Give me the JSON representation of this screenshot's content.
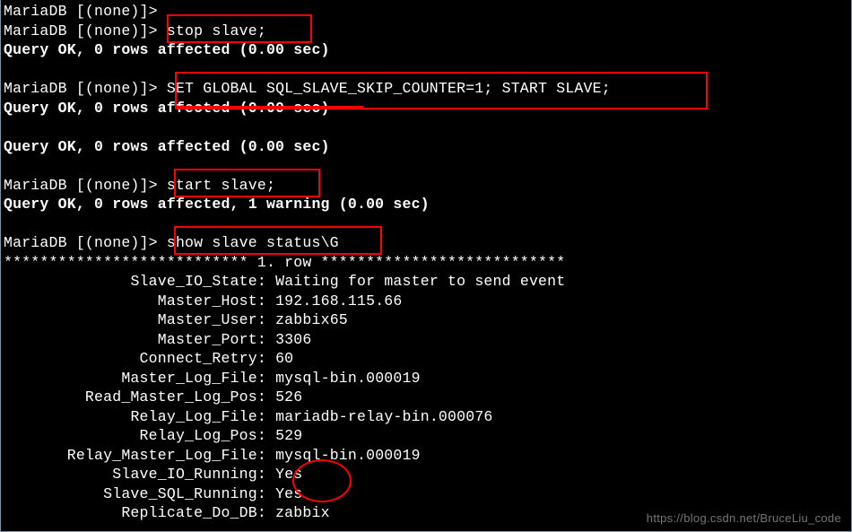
{
  "prompt": "MariaDB [(none)]>",
  "commands": {
    "cmd1_empty": "",
    "cmd2_stop": "stop slave;",
    "cmd3_skip": "SET GLOBAL SQL_SLAVE_SKIP_COUNTER=1; START SLAVE;",
    "cmd4_start": "start slave;",
    "cmd5_status": "show slave status\\G"
  },
  "responses": {
    "ok_0rows": "Query OK, 0 rows affected (0.00 sec)",
    "ok_0rows2": "Query OK, 0 rows affected (0.00 sec)",
    "ok_0rows3": "Query OK, 0 rows affected (0.00 sec)",
    "ok_0rows_warn": "Query OK, 0 rows affected, 1 warning (0.00 sec)"
  },
  "status_header": "*************************** 1. row ***************************",
  "status_rows": [
    {
      "label": "Slave_IO_State",
      "value": "Waiting for master to send event"
    },
    {
      "label": "Master_Host",
      "value": "192.168.115.66"
    },
    {
      "label": "Master_User",
      "value": "zabbix65"
    },
    {
      "label": "Master_Port",
      "value": "3306"
    },
    {
      "label": "Connect_Retry",
      "value": "60"
    },
    {
      "label": "Master_Log_File",
      "value": "mysql-bin.000019"
    },
    {
      "label": "Read_Master_Log_Pos",
      "value": "526"
    },
    {
      "label": "Relay_Log_File",
      "value": "mariadb-relay-bin.000076"
    },
    {
      "label": "Relay_Log_Pos",
      "value": "529"
    },
    {
      "label": "Relay_Master_Log_File",
      "value": "mysql-bin.000019"
    },
    {
      "label": "Slave_IO_Running",
      "value": "Yes"
    },
    {
      "label": "Slave_SQL_Running",
      "value": "Yes"
    },
    {
      "label": "Replicate_Do_DB",
      "value": "zabbix"
    }
  ],
  "watermark": "https://blog.csdn.net/BruceLiu_code"
}
